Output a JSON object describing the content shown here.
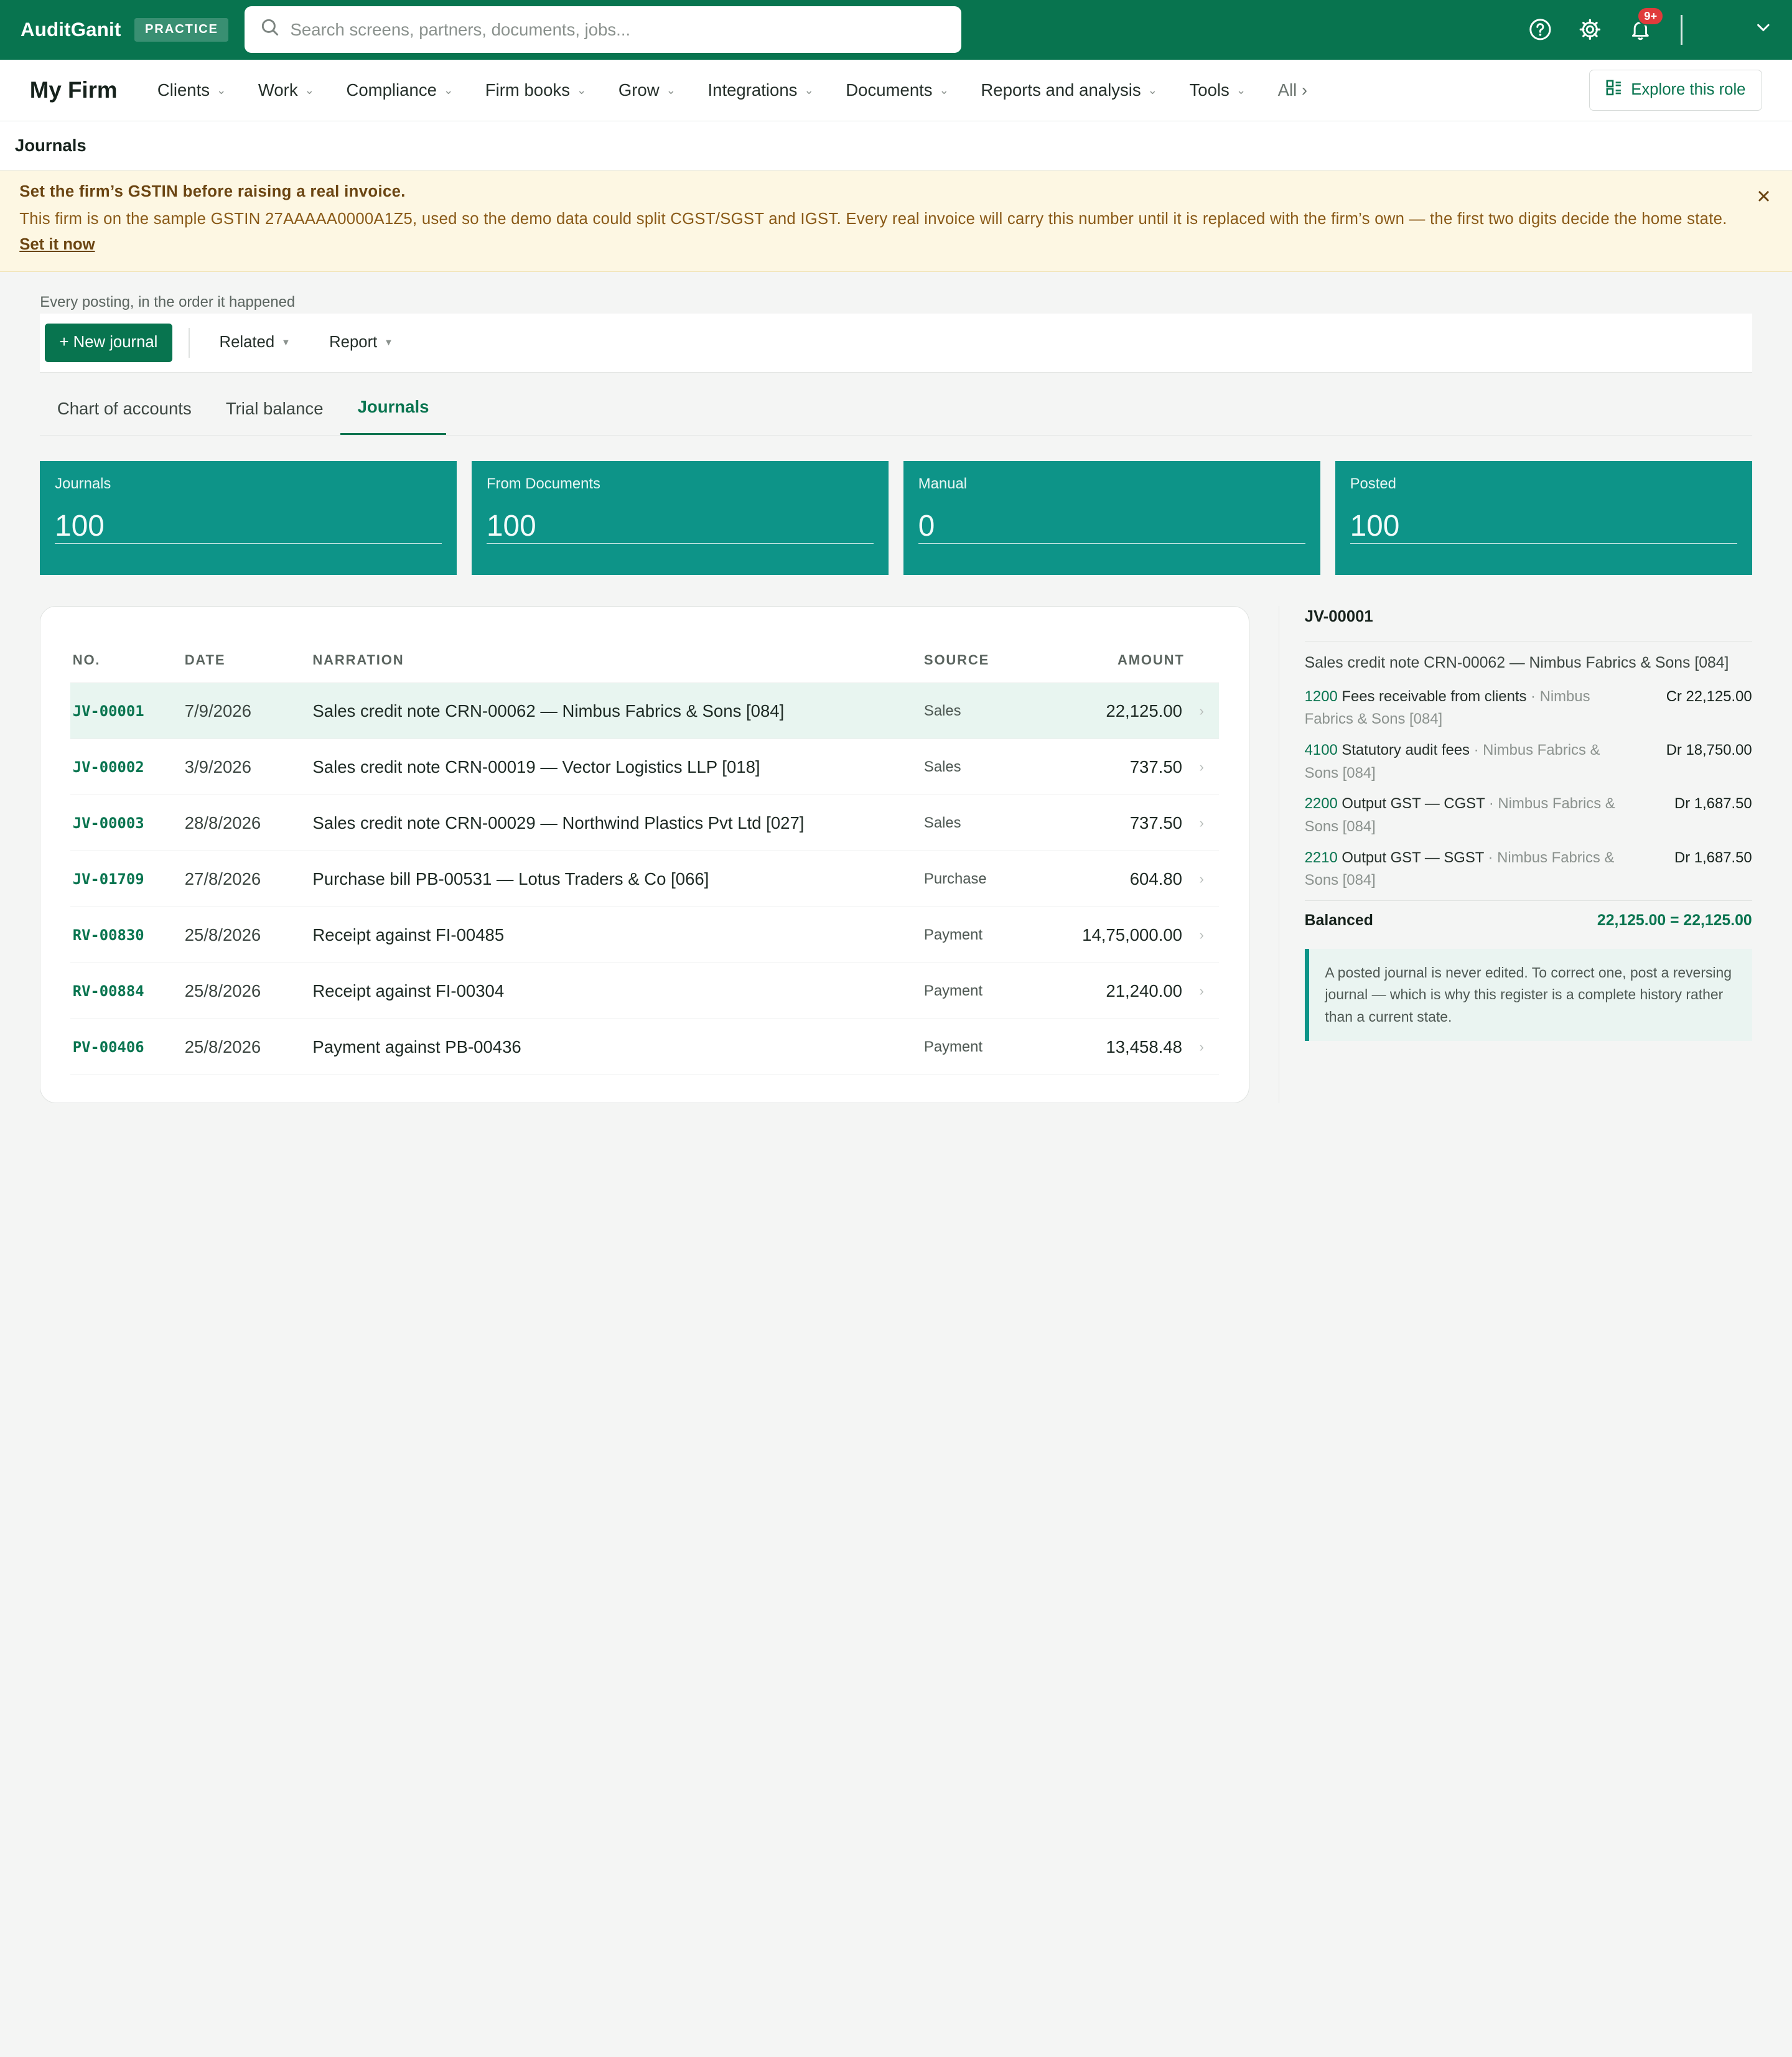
{
  "app": {
    "name": "AuditGanit",
    "badge": "PRACTICE"
  },
  "search": {
    "placeholder": "Search screens, partners, documents, jobs..."
  },
  "notifications": {
    "count": "9+"
  },
  "nav": {
    "title": "My Firm",
    "items": [
      "Clients",
      "Work",
      "Compliance",
      "Firm books",
      "Grow",
      "Integrations",
      "Documents",
      "Reports and analysis",
      "Tools"
    ],
    "all_label": "All ›",
    "explore_label": "Explore this role"
  },
  "page": {
    "title": "Journals"
  },
  "banner": {
    "title": "Set the firm’s GSTIN before raising a real invoice.",
    "text": "This firm is on the sample GSTIN 27AAAAA0000A1Z5, used so the demo data could split CGST/SGST and IGST. Every real invoice will carry this number until it is replaced with the firm’s own — the first two digits decide the home state.",
    "link": "Set it now"
  },
  "content": {
    "subtitle": "Every posting, in the order it happened",
    "new_button": "+ New journal",
    "menus": [
      "Related",
      "Report"
    ],
    "tabs": [
      "Chart of accounts",
      "Trial balance",
      "Journals"
    ],
    "active_tab": "Journals"
  },
  "stats": [
    {
      "label": "Journals",
      "value": "100"
    },
    {
      "label": "From Documents",
      "value": "100"
    },
    {
      "label": "Manual",
      "value": "0"
    },
    {
      "label": "Posted",
      "value": "100"
    }
  ],
  "table": {
    "headers": {
      "no": "NO.",
      "date": "DATE",
      "narration": "NARRATION",
      "source": "SOURCE",
      "amount": "AMOUNT"
    },
    "rows": [
      {
        "no": "JV-00001",
        "date": "7/9/2026",
        "narration": "Sales credit note CRN-00062 — Nimbus Fabrics & Sons [084]",
        "source": "Sales",
        "amount": "22,125.00"
      },
      {
        "no": "JV-00002",
        "date": "3/9/2026",
        "narration": "Sales credit note CRN-00019 — Vector Logistics LLP [018]",
        "source": "Sales",
        "amount": "737.50"
      },
      {
        "no": "JV-00003",
        "date": "28/8/2026",
        "narration": "Sales credit note CRN-00029 — Northwind Plastics Pvt Ltd [027]",
        "source": "Sales",
        "amount": "737.50"
      },
      {
        "no": "JV-01709",
        "date": "27/8/2026",
        "narration": "Purchase bill PB-00531 — Lotus Traders & Co [066]",
        "source": "Purchase",
        "amount": "604.80"
      },
      {
        "no": "RV-00830",
        "date": "25/8/2026",
        "narration": "Receipt against FI-00485",
        "source": "Payment",
        "amount": "14,75,000.00"
      },
      {
        "no": "RV-00884",
        "date": "25/8/2026",
        "narration": "Receipt against FI-00304",
        "source": "Payment",
        "amount": "21,240.00"
      },
      {
        "no": "PV-00406",
        "date": "25/8/2026",
        "narration": "Payment against PB-00436",
        "source": "Payment",
        "amount": "13,458.48"
      }
    ]
  },
  "detail": {
    "id": "JV-00001",
    "narration": "Sales credit note CRN-00062 — Nimbus Fabrics & Sons [084]",
    "lines": [
      {
        "code": "1200",
        "account": "Fees receivable from clients",
        "party": "· Nimbus Fabrics & Sons [084]",
        "amount": "Cr 22,125.00"
      },
      {
        "code": "4100",
        "account": "Statutory audit fees",
        "party": "· Nimbus Fabrics & Sons [084]",
        "amount": "Dr 18,750.00"
      },
      {
        "code": "2200",
        "account": "Output GST — CGST",
        "party": "· Nimbus Fabrics & Sons [084]",
        "amount": "Dr 1,687.50"
      },
      {
        "code": "2210",
        "account": "Output GST — SGST",
        "party": "· Nimbus Fabrics & Sons [084]",
        "amount": "Dr 1,687.50"
      }
    ],
    "balanced_label": "Balanced",
    "balanced_value": "22,125.00 = 22,125.00",
    "note": "A posted journal is never edited. To correct one, post a reversing journal — which is why this register is a complete history rather than a current state."
  },
  "colors": {
    "brand": "#08744f",
    "stat_bg": "#0d9488",
    "banner_bg": "#fdf7e3",
    "badge_red": "#e03b3b"
  }
}
